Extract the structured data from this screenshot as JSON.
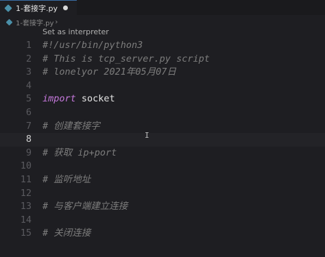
{
  "tab": {
    "label": "1-套接字.py",
    "icon": "python-file-icon",
    "modified": true
  },
  "breadcrumb": {
    "file": "1-套接字.py",
    "separator": "›"
  },
  "codelens": {
    "label": "Set as interpreter"
  },
  "editor": {
    "current_line": 8,
    "lines": [
      {
        "num": "1",
        "kind": "comment",
        "text": "#!/usr/bin/python3"
      },
      {
        "num": "2",
        "kind": "comment",
        "text": "# This is tcp_server.py script"
      },
      {
        "num": "3",
        "kind": "comment",
        "text": "# lonelyor 2021年05月07日"
      },
      {
        "num": "4",
        "kind": "empty",
        "text": ""
      },
      {
        "num": "5",
        "kind": "import",
        "keyword": "import",
        "rest": " socket"
      },
      {
        "num": "6",
        "kind": "empty",
        "text": ""
      },
      {
        "num": "7",
        "kind": "comment",
        "text": "# 创建套接字"
      },
      {
        "num": "8",
        "kind": "empty",
        "text": ""
      },
      {
        "num": "9",
        "kind": "comment",
        "text": "# 获取 ip+port"
      },
      {
        "num": "10",
        "kind": "empty",
        "text": ""
      },
      {
        "num": "11",
        "kind": "comment",
        "text": "# 监听地址"
      },
      {
        "num": "12",
        "kind": "empty",
        "text": ""
      },
      {
        "num": "13",
        "kind": "comment",
        "text": "# 与客户端建立连接"
      },
      {
        "num": "14",
        "kind": "empty",
        "text": ""
      },
      {
        "num": "15",
        "kind": "comment",
        "text": "# 关闭连接"
      }
    ]
  },
  "cursor": {
    "glyph": "I"
  },
  "colors": {
    "background": "#1e1e22",
    "comment": "#7d7d7d",
    "keyword": "#c679dd",
    "line_number": "#5a5a5f",
    "accent": "#3a6ea5"
  }
}
